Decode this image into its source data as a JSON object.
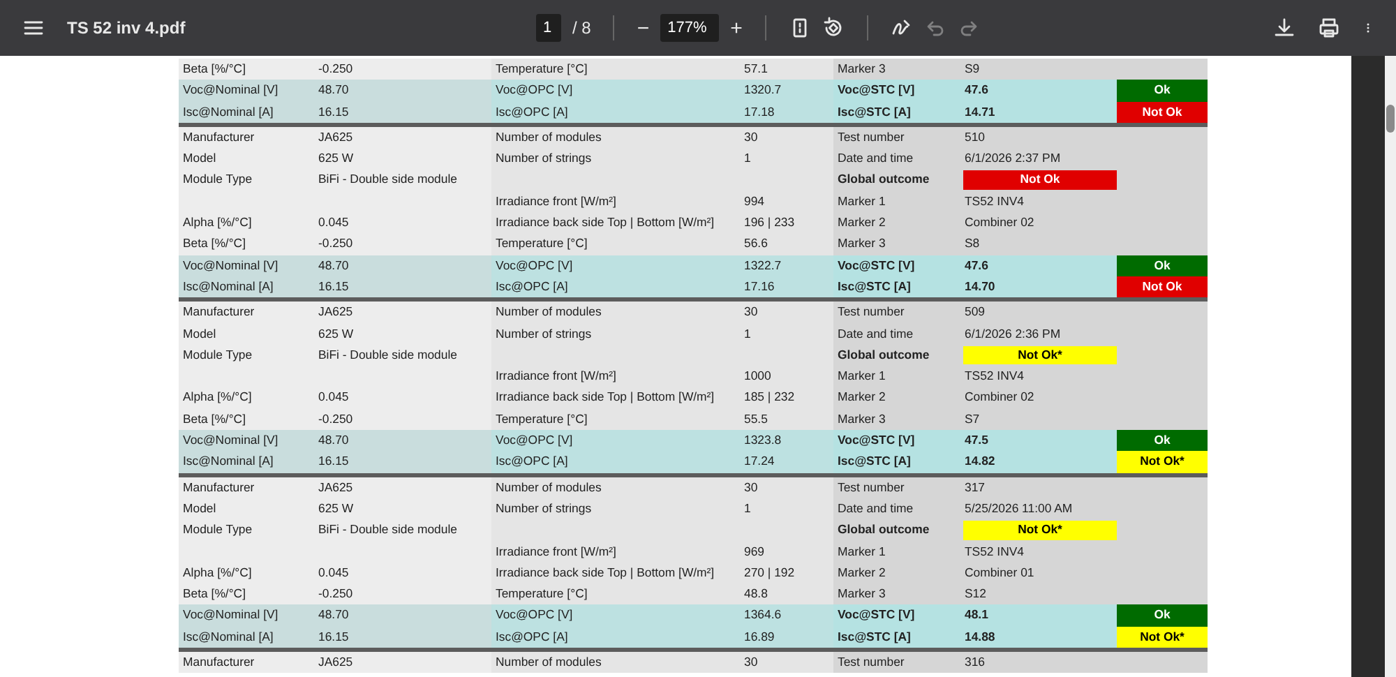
{
  "toolbar": {
    "title": "TS 52 inv 4.pdf",
    "page_input": "1",
    "page_total": "/ 8",
    "zoom_out": "−",
    "zoom": "177%",
    "zoom_in": "+",
    "undo": {
      "disabled": true
    },
    "redo": {
      "disabled": true
    }
  },
  "blocks": [
    {
      "rows": [
        {
          "kind": "info",
          "label_1": "Beta [%/°C]",
          "value_1": "-0.250",
          "label_2": "Temperature [°C]",
          "value_2": "57.1",
          "label_3": "Marker 3",
          "value_3": "S9"
        },
        {
          "kind": "measure",
          "label_1": "Voc@Nominal [V]",
          "value_1": "48.70",
          "label_2": "Voc@OPC [V]",
          "value_2": "1320.7",
          "label_3": "Voc@STC [V]",
          "value_3": "47.6",
          "outcome": {
            "text": "Ok",
            "color": "#006b00"
          }
        },
        {
          "kind": "measure",
          "label_1": "Isc@Nominal [A]",
          "value_1": "16.15",
          "label_2": "Isc@OPC [A]",
          "value_2": "17.18",
          "label_3": "Isc@STC [A]",
          "value_3": "14.71",
          "outcome": {
            "text": "Not Ok",
            "color": "#e00000"
          }
        }
      ]
    },
    {
      "rows": [
        {
          "kind": "info",
          "label_1": "Manufacturer",
          "value_1": "JA625",
          "label_2": "Number of modules",
          "value_2": "30",
          "label_3": "Test number",
          "value_3": "510"
        },
        {
          "kind": "info",
          "label_1": "Model",
          "value_1": "625 W",
          "label_2": "Number of strings",
          "value_2": "1",
          "label_3": "Date and time",
          "value_3": "6/1/2026 2:37 PM"
        },
        {
          "kind": "outcome",
          "label_1": "Module Type",
          "value_1": "BiFi - Double side module",
          "label_3": "Global outcome",
          "outcome": {
            "text": "Not Ok",
            "color": "#e00000"
          }
        },
        {
          "kind": "info",
          "label_2": "Irradiance front [W/m²]",
          "value_2": "994",
          "label_3": "Marker 1",
          "value_3": "TS52 INV4"
        },
        {
          "kind": "info",
          "label_1": "Alpha [%/°C]",
          "value_1": "0.045",
          "label_2": "Irradiance back side Top | Bottom [W/m²]",
          "value_2": "196 | 233",
          "label_3": "Marker 2",
          "value_3": "Combiner 02"
        },
        {
          "kind": "info",
          "label_1": "Beta [%/°C]",
          "value_1": "-0.250",
          "label_2": "Temperature [°C]",
          "value_2": "56.6",
          "label_3": "Marker 3",
          "value_3": "S8"
        },
        {
          "kind": "measure",
          "label_1": "Voc@Nominal [V]",
          "value_1": "48.70",
          "label_2": "Voc@OPC [V]",
          "value_2": "1322.7",
          "label_3": "Voc@STC [V]",
          "value_3": "47.6",
          "outcome": {
            "text": "Ok",
            "color": "#006b00"
          }
        },
        {
          "kind": "measure",
          "label_1": "Isc@Nominal [A]",
          "value_1": "16.15",
          "label_2": "Isc@OPC [A]",
          "value_2": "17.16",
          "label_3": "Isc@STC [A]",
          "value_3": "14.70",
          "outcome": {
            "text": "Not Ok",
            "color": "#e00000"
          }
        }
      ]
    },
    {
      "rows": [
        {
          "kind": "info",
          "label_1": "Manufacturer",
          "value_1": "JA625",
          "label_2": "Number of modules",
          "value_2": "30",
          "label_3": "Test number",
          "value_3": "509"
        },
        {
          "kind": "info",
          "label_1": "Model",
          "value_1": "625 W",
          "label_2": "Number of strings",
          "value_2": "1",
          "label_3": "Date and time",
          "value_3": "6/1/2026 2:36 PM"
        },
        {
          "kind": "outcome",
          "label_1": "Module Type",
          "value_1": "BiFi - Double side module",
          "label_3": "Global outcome",
          "outcome": {
            "text": "Not Ok*",
            "color": "#ffff00"
          }
        },
        {
          "kind": "info",
          "label_2": "Irradiance front [W/m²]",
          "value_2": "1000",
          "label_3": "Marker 1",
          "value_3": "TS52 INV4"
        },
        {
          "kind": "info",
          "label_1": "Alpha [%/°C]",
          "value_1": "0.045",
          "label_2": "Irradiance back side Top | Bottom [W/m²]",
          "value_2": "185 | 232",
          "label_3": "Marker 2",
          "value_3": "Combiner 02"
        },
        {
          "kind": "info",
          "label_1": "Beta [%/°C]",
          "value_1": "-0.250",
          "label_2": "Temperature [°C]",
          "value_2": "55.5",
          "label_3": "Marker 3",
          "value_3": "S7"
        },
        {
          "kind": "measure",
          "label_1": "Voc@Nominal [V]",
          "value_1": "48.70",
          "label_2": "Voc@OPC [V]",
          "value_2": "1323.8",
          "label_3": "Voc@STC [V]",
          "value_3": "47.5",
          "outcome": {
            "text": "Ok",
            "color": "#006b00"
          }
        },
        {
          "kind": "measure",
          "label_1": "Isc@Nominal [A]",
          "value_1": "16.15",
          "label_2": "Isc@OPC [A]",
          "value_2": "17.24",
          "label_3": "Isc@STC [A]",
          "value_3": "14.82",
          "outcome": {
            "text": "Not Ok*",
            "color": "#ffff00"
          }
        }
      ]
    },
    {
      "rows": [
        {
          "kind": "info",
          "label_1": "Manufacturer",
          "value_1": "JA625",
          "label_2": "Number of modules",
          "value_2": "30",
          "label_3": "Test number",
          "value_3": "317"
        },
        {
          "kind": "info",
          "label_1": "Model",
          "value_1": "625 W",
          "label_2": "Number of strings",
          "value_2": "1",
          "label_3": "Date and time",
          "value_3": "5/25/2026 11:00 AM"
        },
        {
          "kind": "outcome",
          "label_1": "Module Type",
          "value_1": "BiFi - Double side module",
          "label_3": "Global outcome",
          "outcome": {
            "text": "Not Ok*",
            "color": "#ffff00"
          }
        },
        {
          "kind": "info",
          "label_2": "Irradiance front [W/m²]",
          "value_2": "969",
          "label_3": "Marker 1",
          "value_3": "TS52 INV4"
        },
        {
          "kind": "info",
          "label_1": "Alpha [%/°C]",
          "value_1": "0.045",
          "label_2": "Irradiance back side Top | Bottom [W/m²]",
          "value_2": "270 | 192",
          "label_3": "Marker 2",
          "value_3": "Combiner 01"
        },
        {
          "kind": "info",
          "label_1": "Beta [%/°C]",
          "value_1": "-0.250",
          "label_2": "Temperature [°C]",
          "value_2": "48.8",
          "label_3": "Marker 3",
          "value_3": "S12"
        },
        {
          "kind": "measure",
          "label_1": "Voc@Nominal [V]",
          "value_1": "48.70",
          "label_2": "Voc@OPC [V]",
          "value_2": "1364.6",
          "label_3": "Voc@STC [V]",
          "value_3": "48.1",
          "outcome": {
            "text": "Ok",
            "color": "#006b00"
          }
        },
        {
          "kind": "measure",
          "label_1": "Isc@Nominal [A]",
          "value_1": "16.15",
          "label_2": "Isc@OPC [A]",
          "value_2": "16.89",
          "label_3": "Isc@STC [A]",
          "value_3": "14.88",
          "outcome": {
            "text": "Not Ok*",
            "color": "#ffff00"
          }
        }
      ]
    },
    {
      "rows": [
        {
          "kind": "info",
          "label_1": "Manufacturer",
          "value_1": "JA625",
          "label_2": "Number of modules",
          "value_2": "30",
          "label_3": "Test number",
          "value_3": "316"
        }
      ]
    }
  ]
}
